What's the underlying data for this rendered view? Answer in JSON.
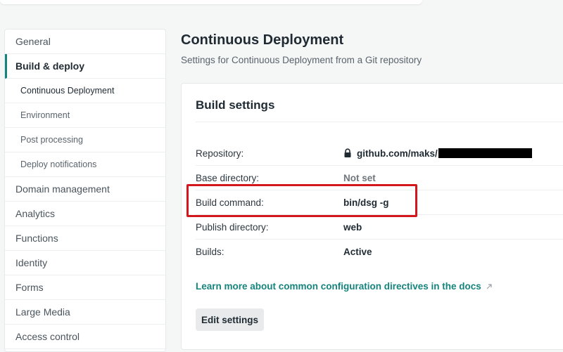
{
  "sidebar": {
    "items": [
      {
        "label": "General"
      },
      {
        "label": "Build & deploy"
      },
      {
        "label": "Continuous Deployment"
      },
      {
        "label": "Environment"
      },
      {
        "label": "Post processing"
      },
      {
        "label": "Deploy notifications"
      },
      {
        "label": "Domain management"
      },
      {
        "label": "Analytics"
      },
      {
        "label": "Functions"
      },
      {
        "label": "Identity"
      },
      {
        "label": "Forms"
      },
      {
        "label": "Large Media"
      },
      {
        "label": "Access control"
      }
    ]
  },
  "main": {
    "title": "Continuous Deployment",
    "subtitle": "Settings for Continuous Deployment from a Git repository"
  },
  "build_settings": {
    "title": "Build settings",
    "rows": [
      {
        "label": "Repository:",
        "value": "github.com/maks/"
      },
      {
        "label": "Base directory:",
        "value": "Not set"
      },
      {
        "label": "Build command:",
        "value": "bin/dsg -g"
      },
      {
        "label": "Publish directory:",
        "value": "web"
      },
      {
        "label": "Builds:",
        "value": "Active"
      }
    ],
    "docs_link": "Learn more about common configuration directives in the docs",
    "edit_button": "Edit settings"
  },
  "icons": {
    "repository": "lock-icon",
    "docs_link": "external-link-icon"
  },
  "colors": {
    "accent": "#15847d",
    "highlight": "#d3171d"
  }
}
